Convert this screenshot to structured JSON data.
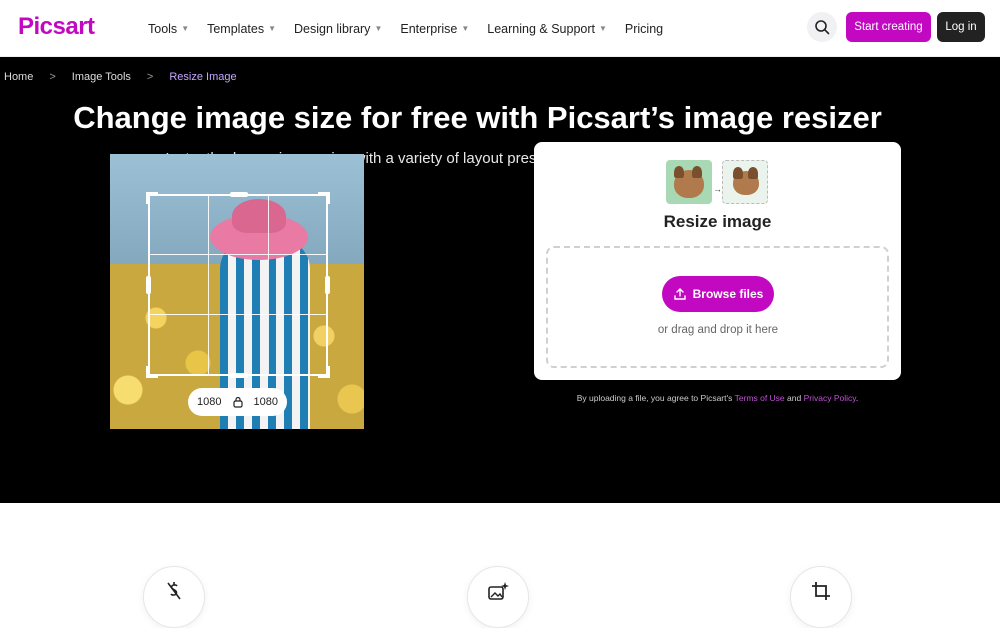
{
  "brand": {
    "logo": "Picsart",
    "accent": "#c209c1"
  },
  "nav": [
    {
      "label": "Tools",
      "dropdown": true
    },
    {
      "label": "Templates",
      "dropdown": true
    },
    {
      "label": "Design library",
      "dropdown": true
    },
    {
      "label": "Enterprise",
      "dropdown": true
    },
    {
      "label": "Learning & Support",
      "dropdown": true
    },
    {
      "label": "Pricing",
      "dropdown": false
    }
  ],
  "header": {
    "start_label": "Start creating",
    "login_label": "Log in"
  },
  "breadcrumb": [
    "Home",
    "Image Tools",
    "Resize Image"
  ],
  "hero": {
    "title": "Change image size for free with Picsart’s image resizer",
    "subtitle": "Instantly change image size with a variety of layout presets using Picsart’s free image resizer."
  },
  "preview": {
    "width": "1080",
    "height": "1080"
  },
  "upload": {
    "title": "Resize image",
    "browse_label": "Browse files",
    "drag_text": "or drag and drop it here",
    "terms_prefix": "By uploading a file, you agree to Picsart's",
    "terms_link": "Terms of Use",
    "terms_and": "and",
    "privacy_link": "Privacy Policy",
    "terms_suffix": "."
  },
  "features": [
    {
      "icon": "dollar-off-icon"
    },
    {
      "icon": "image-sparkle-icon"
    },
    {
      "icon": "crop-icon"
    }
  ]
}
